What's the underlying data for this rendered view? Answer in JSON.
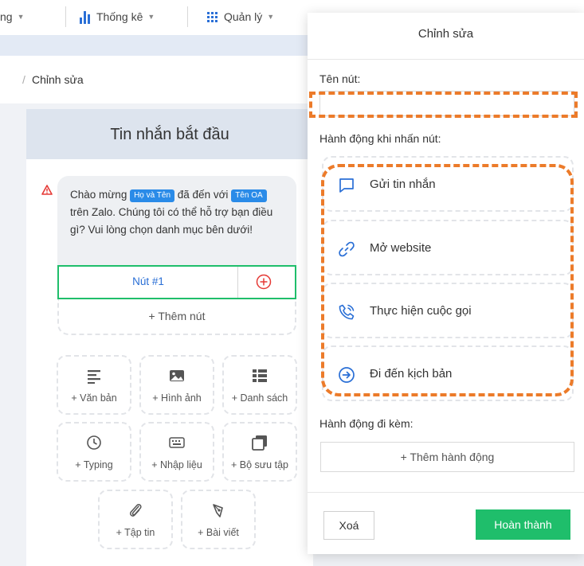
{
  "toolbar": {
    "item1_label": "ng",
    "stats_label": "Thống kê",
    "manage_label": "Quản lý",
    "caret": "▼"
  },
  "breadcrumb": {
    "slash": "/",
    "label": "Chỉnh sửa"
  },
  "editor": {
    "title": "Tin nhắn bắt đầu",
    "message": {
      "part1": "Chào mừng ",
      "tag_name": "Họ và Tên",
      "part2": " đã đến với ",
      "tag_oa": "Tên OA",
      "part3": " trên Zalo. Chúng tôi có thể hỗ trợ bạn điều gì? Vui lòng chọn danh mục bên dưới!"
    },
    "button_label": "Nút #1",
    "add_button_label": "+  Thêm nút",
    "blocks": [
      {
        "label": "+ Văn bản",
        "icon": "text-lines-icon"
      },
      {
        "label": "+ Hình ảnh",
        "icon": "image-icon"
      },
      {
        "label": "+ Danh sách",
        "icon": "list-icon"
      },
      {
        "label": "+ Typing",
        "icon": "clock-icon"
      },
      {
        "label": "+ Nhập liệu",
        "icon": "keyboard-icon"
      },
      {
        "label": "+ Bộ sưu tập",
        "icon": "gallery-icon"
      },
      {
        "label": "+ Tập tin",
        "icon": "paperclip-icon"
      },
      {
        "label": "+ Bài viết",
        "icon": "pen-icon"
      }
    ]
  },
  "modal": {
    "title": "Chỉnh sửa",
    "name_label": "Tên nút:",
    "name_value": "",
    "action_label": "Hành động khi nhấn nút:",
    "actions": [
      {
        "label": "Gửi tin nhắn",
        "icon": "chat-icon"
      },
      {
        "label": "Mở website",
        "icon": "link-icon"
      },
      {
        "label": "Thực hiện cuộc gọi",
        "icon": "phone-icon"
      },
      {
        "label": "Đi đến kịch bản",
        "icon": "arrow-circle-icon"
      }
    ],
    "extra_label": "Hành động đi kèm:",
    "add_action_label": "+  Thêm hành động",
    "delete_label": "Xoá",
    "done_label": "Hoàn thành"
  },
  "colors": {
    "accent_blue": "#2a6fd6",
    "green": "#1fbe6b",
    "highlight_orange": "#ec7b2a",
    "warning_red": "#e53935"
  }
}
